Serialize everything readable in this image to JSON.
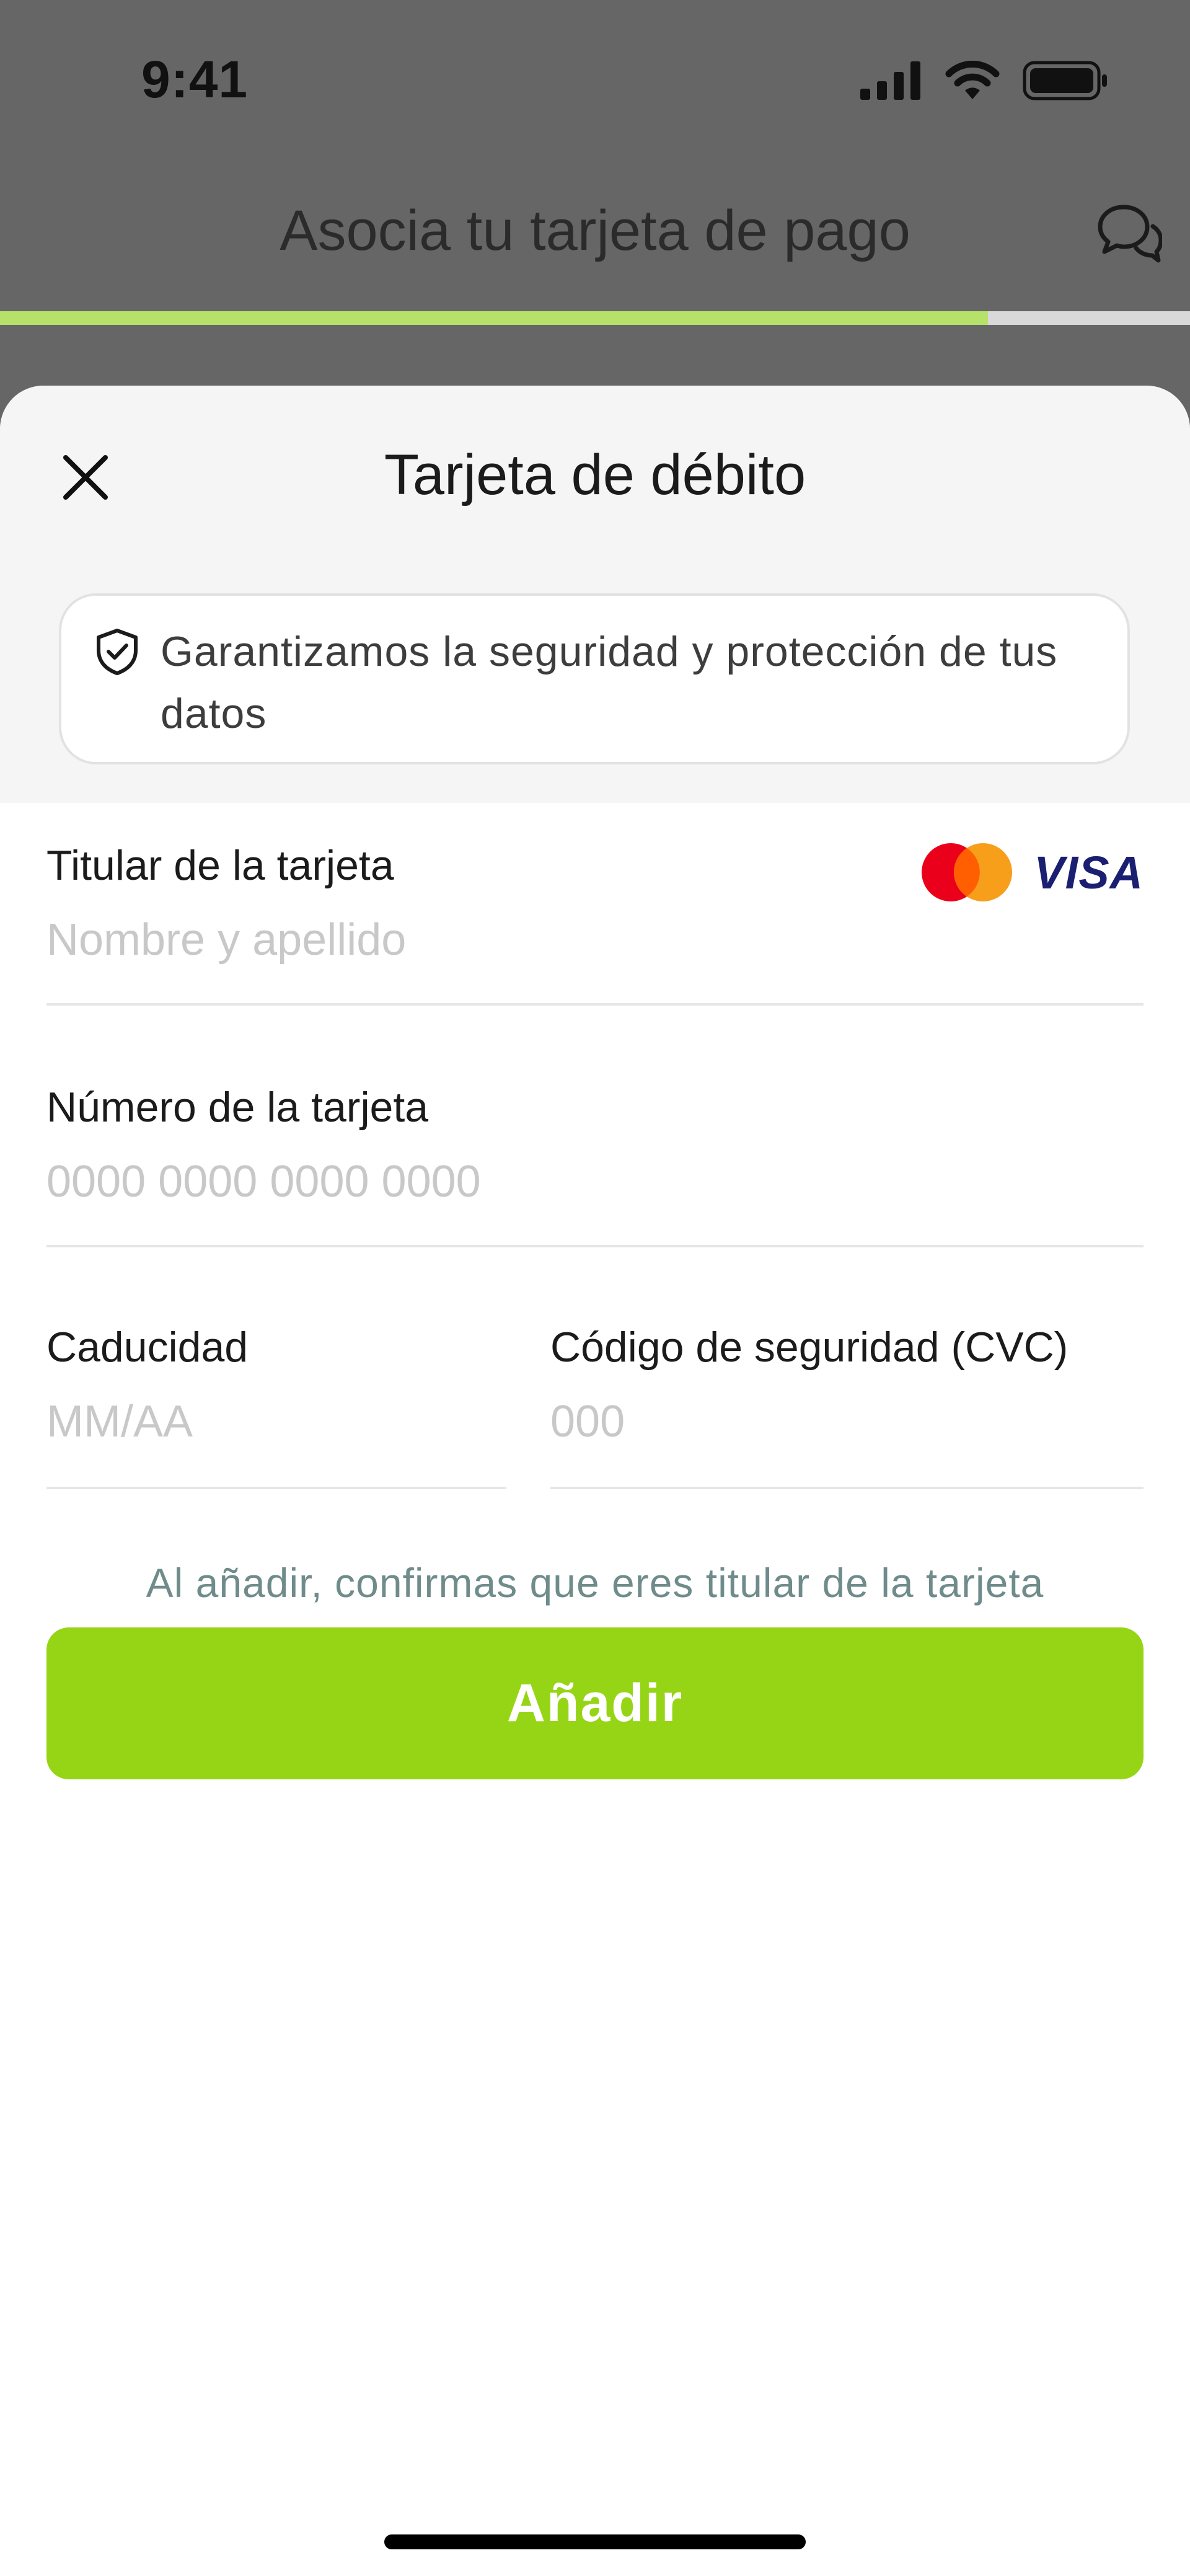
{
  "status_bar": {
    "time": "9:41"
  },
  "nav": {
    "title": "Asocia tu tarjeta de pago"
  },
  "progress": {
    "fraction": 0.83,
    "fill_color": "#b7e26a",
    "track_color": "#d9d9d9"
  },
  "sheet": {
    "title": "Tarjeta de débito",
    "close_icon": "close-icon",
    "notice": {
      "icon": "shield-check-icon",
      "text": "Garantizamos la seguridad y protección de tus datos"
    },
    "brands": {
      "visa": "VISA"
    },
    "fields": {
      "holder": {
        "label": "Titular de la tarjeta",
        "placeholder": "Nombre y apellido",
        "value": ""
      },
      "number": {
        "label": "Número de la tarjeta",
        "placeholder": "0000 0000 0000 0000",
        "value": ""
      },
      "expiry": {
        "label": "Caducidad",
        "placeholder": "MM/AA",
        "value": ""
      },
      "cvc": {
        "label": "Código de seguridad (CVC)",
        "placeholder": "000",
        "value": ""
      }
    },
    "disclaimer": "Al añadir, confirmas que eres titular de la tarjeta",
    "add_label": "Añadir"
  },
  "colors": {
    "accent": "#96d516",
    "disclaimer": "#6f8c8b",
    "backdrop": "#666666"
  }
}
